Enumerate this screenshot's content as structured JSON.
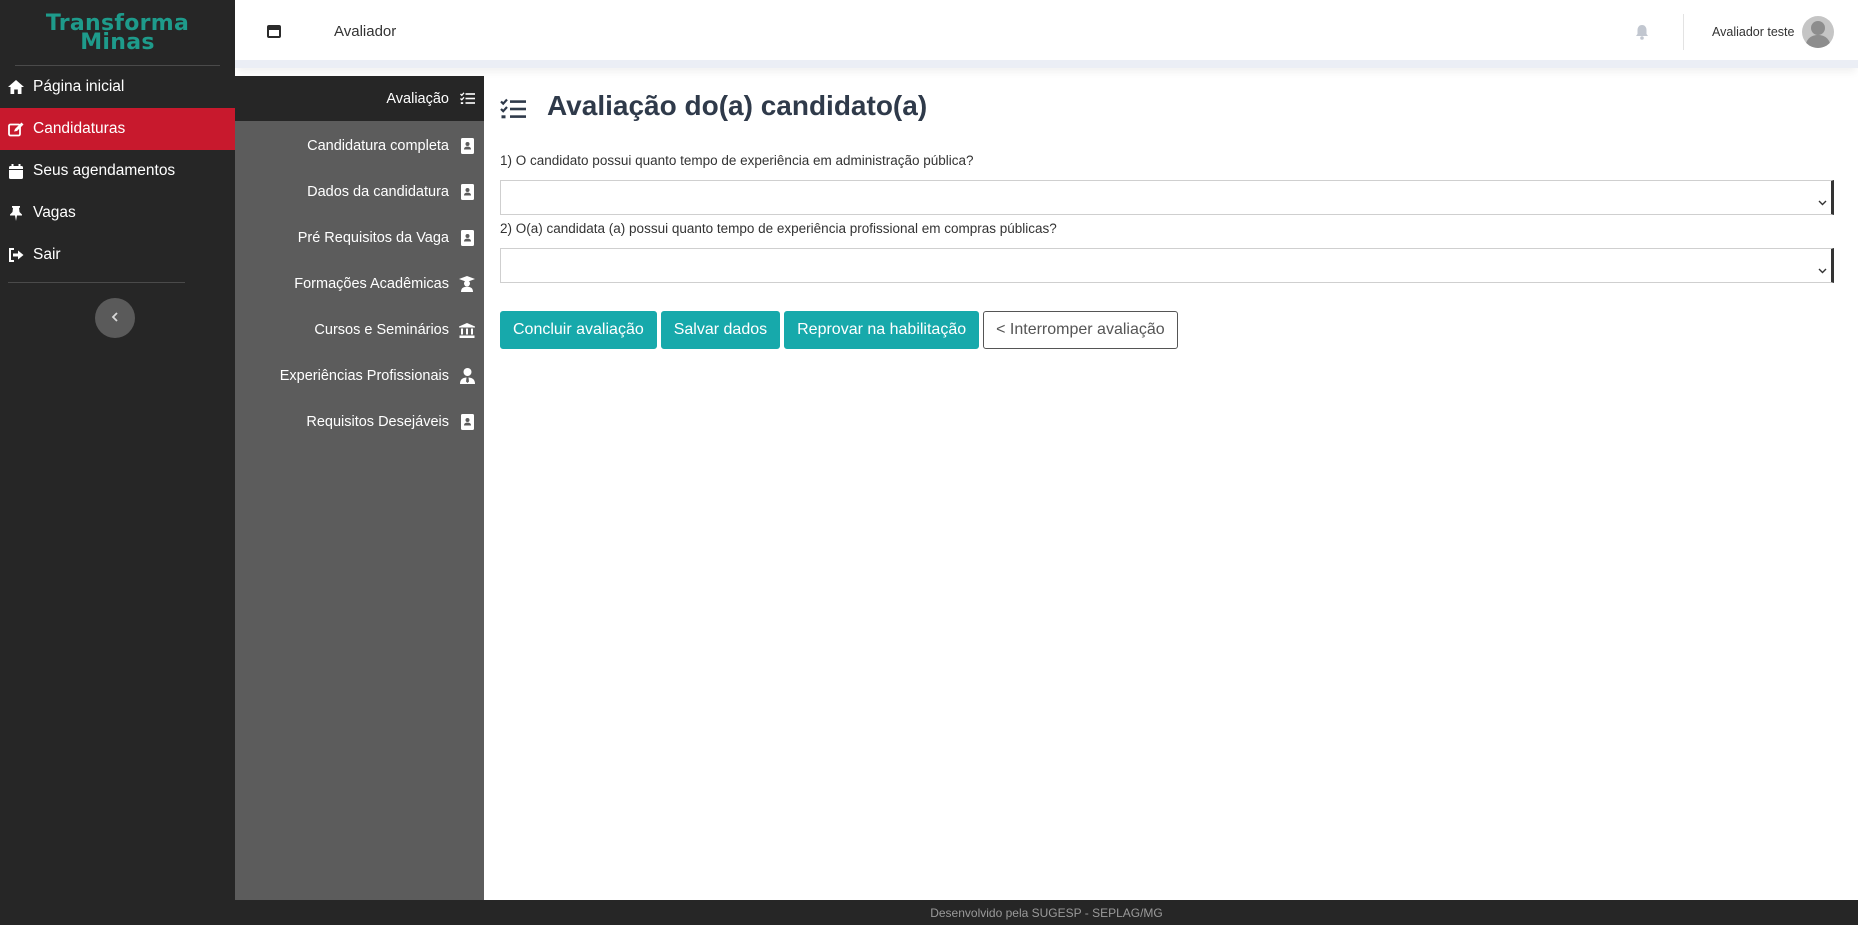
{
  "brand": {
    "line1": "Transforma",
    "line2": "Minas"
  },
  "sidebar": {
    "items": [
      {
        "label": "Página inicial",
        "icon": "home-icon"
      },
      {
        "label": "Candidaturas",
        "icon": "edit-icon",
        "active": true
      },
      {
        "label": "Seus agendamentos",
        "icon": "calendar-icon"
      },
      {
        "label": "Vagas",
        "icon": "pin-icon"
      },
      {
        "label": "Sair",
        "icon": "sign-out-icon"
      }
    ]
  },
  "header": {
    "title": "Avaliador",
    "user_name": "Avaliador teste"
  },
  "subnav": {
    "head": "Avaliação",
    "items": [
      {
        "label": "Candidatura completa",
        "icon": "id-card-icon"
      },
      {
        "label": "Dados da candidatura",
        "icon": "id-card-icon"
      },
      {
        "label": "Pré Requisitos da Vaga",
        "icon": "id-card-icon"
      },
      {
        "label": "Formações Acadêmicas",
        "icon": "graduate-icon"
      },
      {
        "label": "Cursos e Seminários",
        "icon": "institution-icon"
      },
      {
        "label": "Experiências Profissionais",
        "icon": "user-tie-icon"
      },
      {
        "label": "Requisitos Desejáveis",
        "icon": "id-card-icon"
      }
    ]
  },
  "main": {
    "title": "Avaliação do(a) candidato(a)",
    "questions": [
      {
        "label": "1) O candidato possui quanto tempo de experiência em administração pública?",
        "value": ""
      },
      {
        "label": "2) O(a) candidata (a) possui quanto tempo de experiência profissional em compras públicas?",
        "value": ""
      }
    ],
    "buttons": {
      "conclude": "Concluir avaliação",
      "save": "Salvar dados",
      "reject": "Reprovar na habilitação",
      "interrupt": "< Interromper avaliação"
    }
  },
  "footer": {
    "text": "Desenvolvido pela SUGESP - SEPLAG/MG"
  },
  "colors": {
    "accent_red": "#c8192d",
    "accent_teal": "#17a9ab",
    "sidebar_dark": "#262626",
    "subnav_grey": "#5c5c5c"
  }
}
